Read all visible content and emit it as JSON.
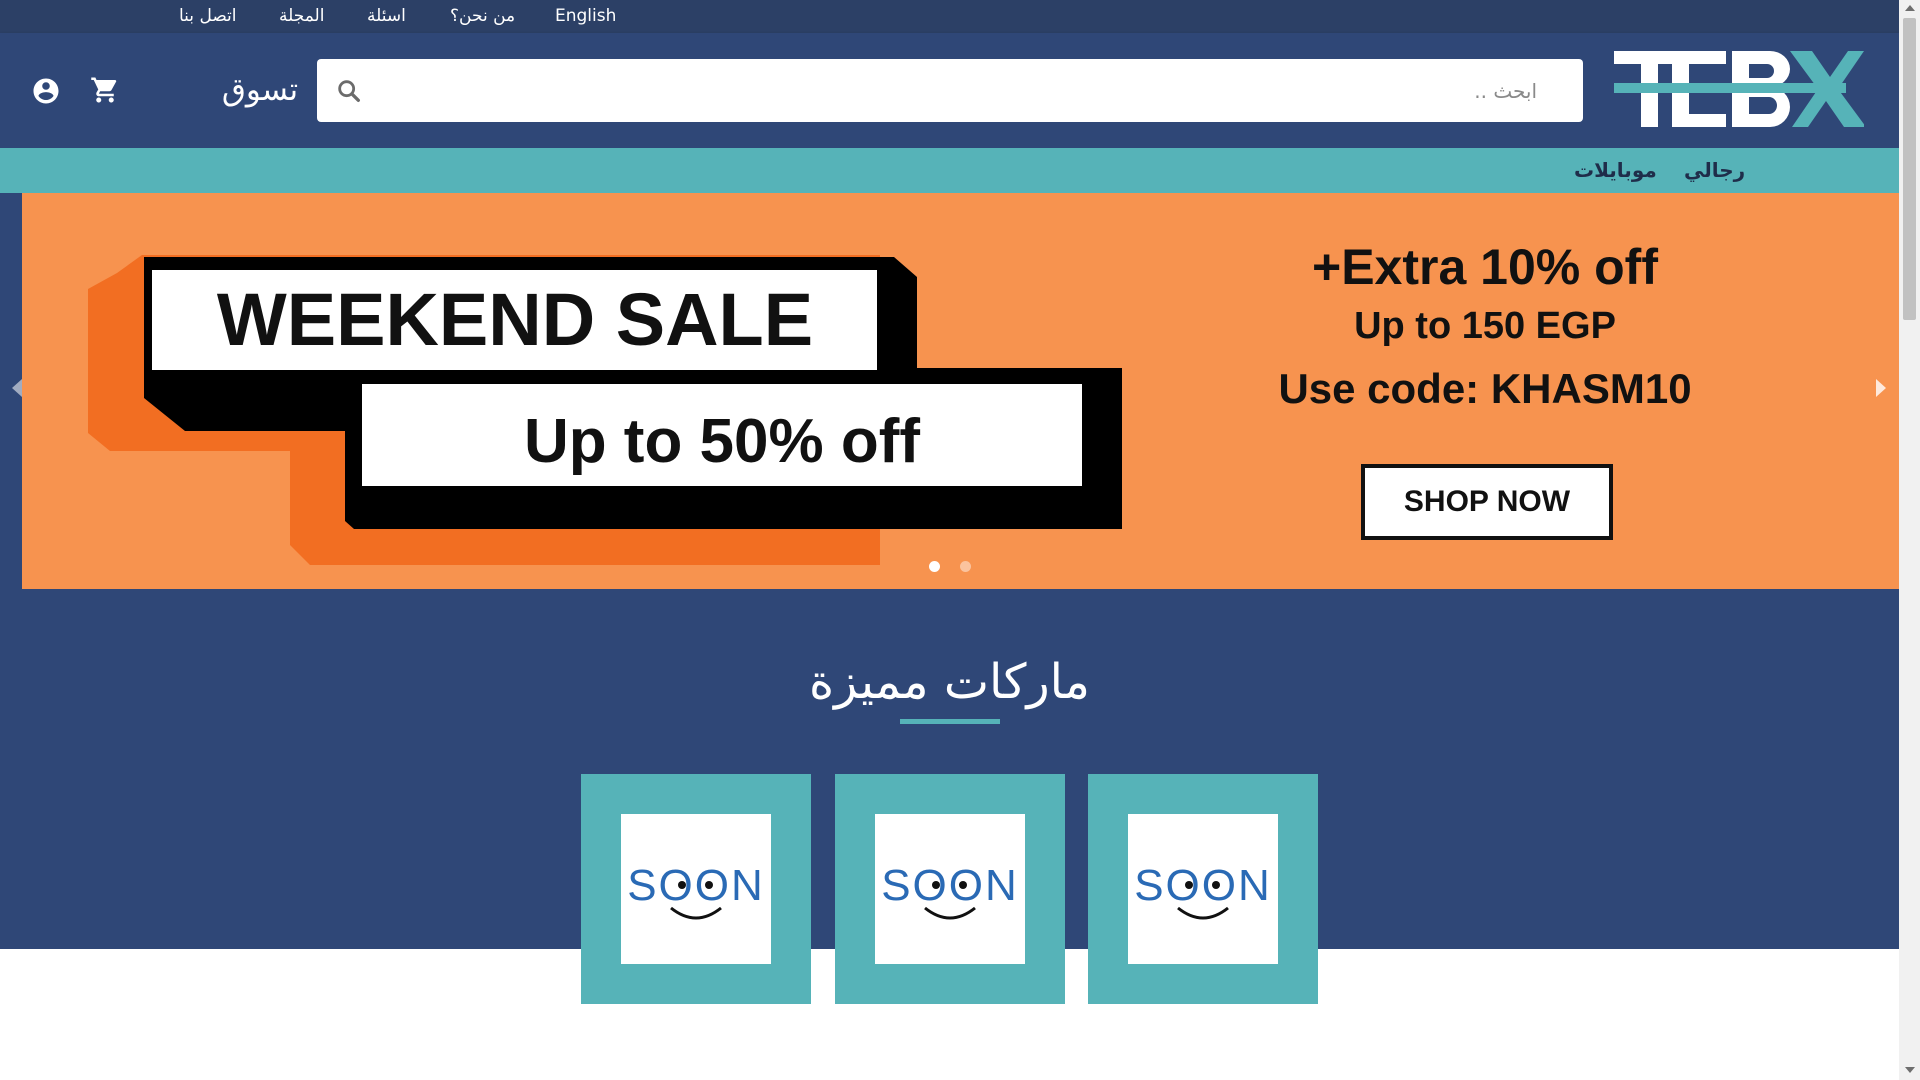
{
  "topbar": {
    "links": [
      "English",
      "من نحن؟",
      "اسئلة",
      "المجلة",
      "اتصل بنا"
    ]
  },
  "header": {
    "logo_text": "TEBX",
    "search_placeholder": "ابحث ..",
    "shop_label": "تسوق",
    "icons": [
      "search-icon",
      "cart-icon",
      "account-icon"
    ]
  },
  "categories": [
    "رجالي",
    "موبايلات"
  ],
  "banner": {
    "headline": "WEEKEND SALE",
    "subheadline": "Up to 50% off",
    "extra": "+Extra 10% off",
    "cap": "Up to 150 EGP",
    "code_line": "Use code: KHASM10",
    "cta": "SHOP NOW",
    "slide_count": 2,
    "active_slide": 1
  },
  "brands": {
    "title": "ماركات مميزة",
    "items": [
      {
        "label": "SOON"
      },
      {
        "label": "SOON"
      },
      {
        "label": "SOON"
      }
    ]
  },
  "colors": {
    "topbar": "#2c4066",
    "header": "#2f4777",
    "accent": "#56b3b8",
    "banner": "#f7934f",
    "banner_orange": "#f26e22"
  }
}
